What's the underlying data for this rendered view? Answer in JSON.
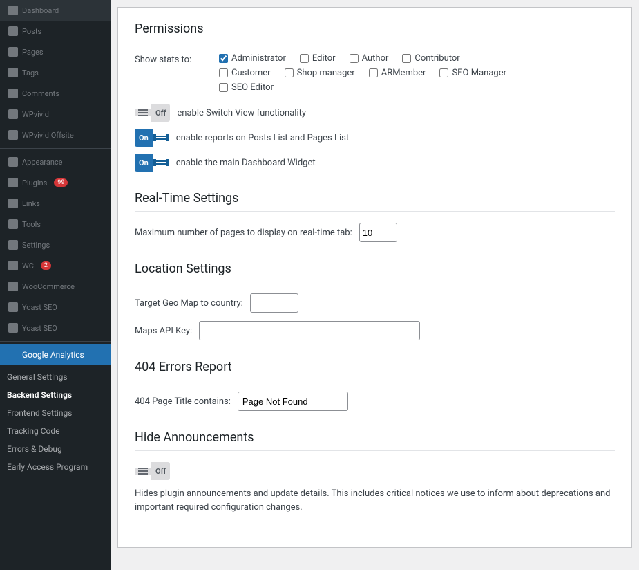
{
  "sidebar": {
    "items": [
      {
        "label": "Dashboard",
        "icon": "dashboard-icon",
        "active": false
      },
      {
        "label": "Posts",
        "icon": "posts-icon",
        "active": false
      },
      {
        "label": "Pages",
        "icon": "pages-icon",
        "active": false
      },
      {
        "label": "Tags",
        "icon": "tags-icon",
        "active": false
      },
      {
        "label": "Comments",
        "icon": "comments-icon",
        "active": false
      },
      {
        "label": "WPvivid",
        "icon": "wpvivid-icon",
        "active": false
      },
      {
        "label": "WPvivid Offsite",
        "icon": "wpvivid-offsite-icon",
        "active": false
      },
      {
        "label": "Appearance",
        "icon": "appearance-icon",
        "active": false
      },
      {
        "label": "Plugins",
        "icon": "plugins-icon",
        "badge": "99",
        "active": false
      },
      {
        "label": "Links",
        "icon": "links-icon",
        "active": false
      },
      {
        "label": "Tools",
        "icon": "tools-icon",
        "active": false
      },
      {
        "label": "Settings",
        "icon": "settings-icon",
        "active": false
      },
      {
        "label": "WC",
        "icon": "wc-icon",
        "badge": "2",
        "active": false
      },
      {
        "label": "WooCommerce",
        "icon": "woocommerce-icon",
        "active": false
      },
      {
        "label": "Yoast SEO",
        "icon": "yoast-icon",
        "active": false
      },
      {
        "label": "Yoast SEO",
        "icon": "yoast2-icon",
        "active": false
      },
      {
        "label": "Google Analytics",
        "icon": "analytics-icon",
        "active": true
      }
    ],
    "sub_items": [
      {
        "label": "General Settings",
        "active": false
      },
      {
        "label": "Backend Settings",
        "active": true
      },
      {
        "label": "Frontend Settings",
        "active": false
      },
      {
        "label": "Tracking Code",
        "active": false
      },
      {
        "label": "Errors & Debug",
        "active": false
      },
      {
        "label": "Early Access Program",
        "active": false
      }
    ]
  },
  "permissions": {
    "section_title": "Permissions",
    "show_stats_label": "Show stats to:",
    "checkboxes": [
      {
        "label": "Administrator",
        "checked": true
      },
      {
        "label": "Editor",
        "checked": false
      },
      {
        "label": "Author",
        "checked": false
      },
      {
        "label": "Contributor",
        "checked": false
      },
      {
        "label": "Customer",
        "checked": false
      },
      {
        "label": "Shop manager",
        "checked": false
      },
      {
        "label": "ARMember",
        "checked": false
      },
      {
        "label": "SEO Manager",
        "checked": false
      },
      {
        "label": "SEO Editor",
        "checked": false
      }
    ],
    "toggles": [
      {
        "state": "off",
        "label": "enable Switch View functionality"
      },
      {
        "state": "on",
        "label": "enable reports on Posts List and Pages List"
      },
      {
        "state": "on",
        "label": "enable the main Dashboard Widget"
      }
    ]
  },
  "realtime": {
    "section_title": "Real-Time Settings",
    "max_pages_label": "Maximum number of pages to display on real-time tab:",
    "max_pages_value": "10"
  },
  "location": {
    "section_title": "Location Settings",
    "geo_map_label": "Target Geo Map to country:",
    "geo_map_value": "",
    "maps_api_label": "Maps API Key:",
    "maps_api_value": ""
  },
  "errors404": {
    "section_title": "404 Errors Report",
    "page_title_label": "404 Page Title contains:",
    "page_title_value": "Page Not Found"
  },
  "hide_announcements": {
    "section_title": "Hide Announcements",
    "toggle_state": "off",
    "description": "Hides plugin announcements and update details. This includes critical notices we use to inform about deprecations and important required configuration changes."
  }
}
